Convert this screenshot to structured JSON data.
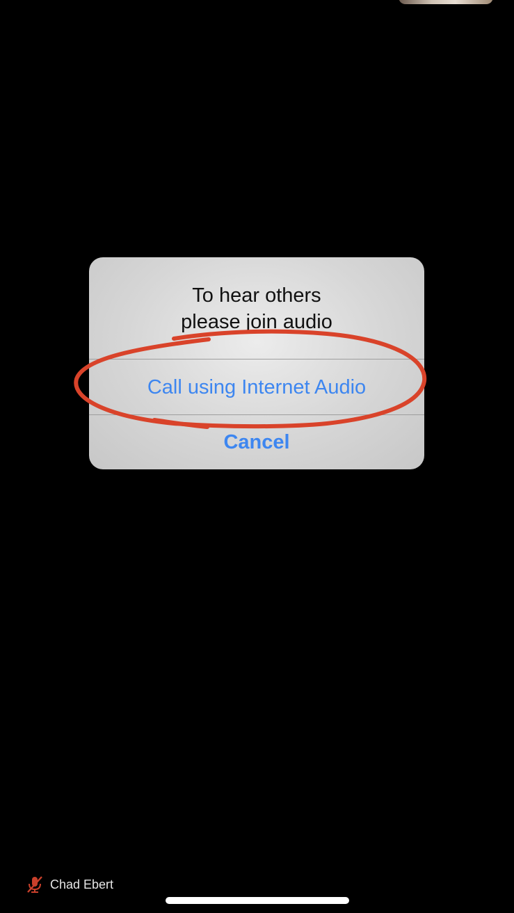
{
  "alert": {
    "title": "To hear others\nplease join audio",
    "primary_action": "Call using Internet Audio",
    "cancel_action": "Cancel"
  },
  "participant": {
    "name": "Chad Ebert",
    "mic_icon": "mic-muted-icon"
  },
  "colors": {
    "background": "#000000",
    "action_blue": "#3d86f0",
    "annotation_red": "#d9432a",
    "muted_icon_red": "#c9402b"
  }
}
